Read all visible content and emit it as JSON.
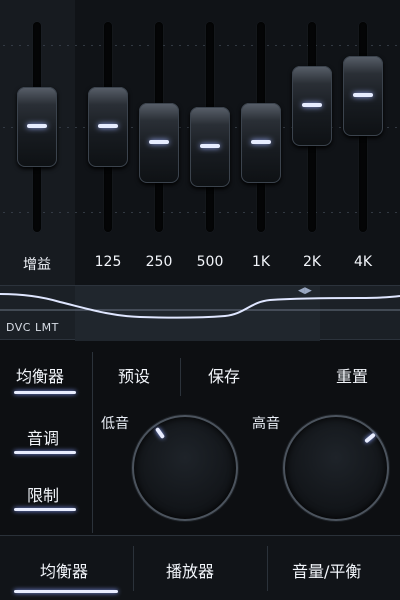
{
  "equalizer": {
    "gain_label": "增益",
    "bands": [
      {
        "label": "125"
      },
      {
        "label": "250"
      },
      {
        "label": "500"
      },
      {
        "label": "1K"
      },
      {
        "label": "2K"
      },
      {
        "label": "4K"
      }
    ],
    "levels": [
      0.48,
      0.48,
      0.39,
      0.37,
      0.39,
      0.65,
      0.71
    ],
    "accent_color": "#e6ecff"
  },
  "curve": {
    "label": "DVC LMT",
    "scroll_hint": "◀▶"
  },
  "tabs": {
    "equalizer": "均衡器",
    "presets": "预设",
    "save": "保存",
    "reset": "重置"
  },
  "left_menu": {
    "tone": "音调",
    "limit": "限制"
  },
  "knobs": {
    "bass_label": "低音",
    "treble_label": "高音"
  },
  "bottom_nav": {
    "equalizer": "均衡器",
    "player": "播放器",
    "volume_balance": "音量/平衡"
  }
}
